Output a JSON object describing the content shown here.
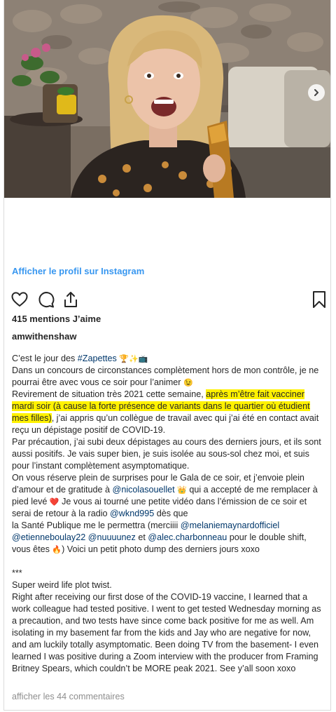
{
  "media": {
    "next_icon": "chevron-right-icon"
  },
  "profile_link": "Afficher le profil sur Instagram",
  "actions": {
    "like_icon": "heart-icon",
    "comment_icon": "comment-icon",
    "share_icon": "share-icon",
    "save_icon": "bookmark-icon"
  },
  "likes": "415 mentions J’aime",
  "username": "amwithenshaw",
  "caption": {
    "l1_text": "C’est le jour des ",
    "l1_tag": "#Zapettes",
    "l2": "Dans un concours de circonstances complètement hors de mon contrôle, je ne pourrai être avec vous ce soir pour l’animer",
    "l3_a": "Revirement de situation très 2021 cette semaine, ",
    "l3_hl": "après m’être fait vacciner mardi soir (à cause la forte présence de variants dans le quartier où étudient mes filles)",
    "l3_b": ", j’ai appris qu’un collègue de travail avec qui j’ai été en contact avait reçu un dépistage positif de COVID-19.",
    "l4": "Par précaution, j’ai subi deux dépistages au cours des derniers jours, et ils sont aussi positifs. Je vais super bien, je suis isolée au sous-sol chez moi, et suis pour l’instant complètement asymptomatique.",
    "l5_a": "On vous réserve plein de surprises pour le Gala de ce soir, et j’envoie plein d’amour et de gratitude à ",
    "l5_tag1": "@nicolasouellet",
    "l5_b": " qui a accepté de me remplacer à pied levé ",
    "l5_c": " Je vous ai tourné une petite vidéo dans l’émission de ce soir et serai de retour à la radio ",
    "l5_tag2": "@wknd995",
    "l5_d": " dès que",
    "l6_a": "la Santé Publique me le permettra (merciiii ",
    "l6_tag1": "@melaniemaynardofficiel",
    "l6_tag2": "@etienneboulay22",
    "l6_tag3": "@nuuuunez",
    "l6_b": " et ",
    "l6_tag4": "@alec.charbonneau",
    "l6_c": " pour le double shift, vous êtes ",
    "l6_d": ") Voici un petit photo dump des derniers jours xoxo",
    "stars": "***",
    "en1": "Super weird life plot twist.",
    "en2": "Right after receiving our first dose of the COVID-19 vaccine, I learned that a work colleague had tested positive. I went to get tested Wednesday morning as a precaution, and two tests have since come back positive for me as well. Am isolating in my basement far from the kids and Jay who are negative for now, and am luckily totally asymptomatic. Been doing TV from the basement- I even learned I was positive during a Zoom interview with the producer from Framing Britney Spears, which couldn’t be MORE peak 2021. See y’all soon xoxo"
  },
  "comments_link": "afficher les 44 commentaires"
}
